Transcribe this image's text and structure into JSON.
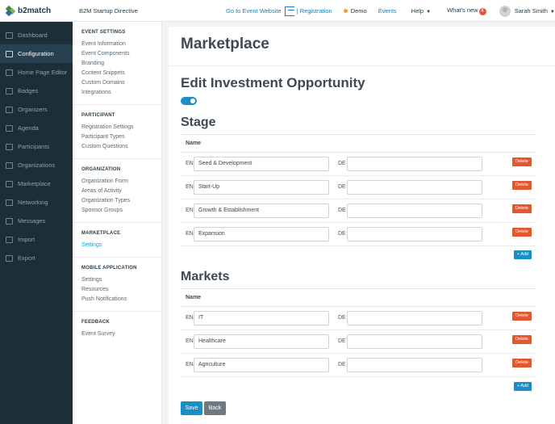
{
  "topbar": {
    "logo": "b2match",
    "event_name": "B2M Startup Directive",
    "go_to_website": "Go to Event Website",
    "registration": "| Registration",
    "demo": "Demo",
    "events": "Events",
    "help": "Help",
    "whats_new": "What's new",
    "whats_new_count": "4",
    "user_name": "Sarah Smith",
    "caret": "▼"
  },
  "sidebar": {
    "items": [
      {
        "label": "Dashboard",
        "icon": "dashboard-icon"
      },
      {
        "label": "Configuration",
        "icon": "configuration-icon"
      },
      {
        "label": "Home Page Editor",
        "icon": "home-page-editor-icon"
      },
      {
        "label": "Badges",
        "icon": "badges-icon"
      },
      {
        "label": "Organizers",
        "icon": "organizers-icon"
      },
      {
        "label": "Agenda",
        "icon": "agenda-icon"
      },
      {
        "label": "Participants",
        "icon": "participants-icon"
      },
      {
        "label": "Organizations",
        "icon": "organizations-icon"
      },
      {
        "label": "Marketplace",
        "icon": "marketplace-icon"
      },
      {
        "label": "Networking",
        "icon": "networking-icon"
      },
      {
        "label": "Messages",
        "icon": "messages-icon"
      },
      {
        "label": "Import",
        "icon": "import-icon"
      },
      {
        "label": "Export",
        "icon": "export-icon"
      }
    ],
    "active": "Configuration"
  },
  "settings_nav": {
    "groups": [
      {
        "heading": "EVENT SETTINGS",
        "links": [
          "Event Information",
          "Event Components",
          "Branding",
          "Content Snippets",
          "Custom Domains",
          "Integrations"
        ]
      },
      {
        "heading": "PARTICIPANT",
        "links": [
          "Registration Settings",
          "Participant Types",
          "Custom Questions"
        ]
      },
      {
        "heading": "ORGANIZATION",
        "links": [
          "Organization Form",
          "Areas of Activity",
          "Organization Types",
          "Sponsor Groups"
        ]
      },
      {
        "heading": "MARKETPLACE",
        "links": [
          "Settings"
        ]
      },
      {
        "heading": "MOBILE APPLICATION",
        "links": [
          "Settings",
          "Resources",
          "Push Notifications"
        ]
      },
      {
        "heading": "FEEDBACK",
        "links": [
          "Event Survey"
        ]
      }
    ],
    "active_link": "MARKETPLACE/Settings"
  },
  "main": {
    "page_title": "Marketplace",
    "form_title": "Edit Investment Opportunity",
    "toggle_on": true,
    "stage": {
      "title": "Stage",
      "column_name": "Name",
      "rows": [
        {
          "en_label": "EN",
          "en_value": "Seed & Development",
          "de_label": "DE",
          "de_value": "",
          "delete": "Delete"
        },
        {
          "en_label": "EN",
          "en_value": "Start-Up",
          "de_label": "DE",
          "de_value": "",
          "delete": "Delete"
        },
        {
          "en_label": "EN",
          "en_value": "Growth & Establishment",
          "de_label": "DE",
          "de_value": "",
          "delete": "Delete"
        },
        {
          "en_label": "EN",
          "en_value": "Expansion",
          "de_label": "DE",
          "de_value": "",
          "delete": "Delete"
        }
      ],
      "add_label": "+ Add"
    },
    "markets": {
      "title": "Markets",
      "column_name": "Name",
      "rows": [
        {
          "en_label": "EN",
          "en_value": "IT",
          "de_label": "DE",
          "de_value": "",
          "delete": "Delete"
        },
        {
          "en_label": "EN",
          "en_value": "Healthcare",
          "de_label": "DE",
          "de_value": "",
          "delete": "Delete"
        },
        {
          "en_label": "EN",
          "en_value": "Agriculture",
          "de_label": "DE",
          "de_value": "",
          "delete": "Delete"
        }
      ],
      "add_label": "+ Add"
    },
    "save_label": "Save",
    "back_label": "Back"
  },
  "colors": {
    "sidebar_bg": "#1c2e38",
    "accent_blue": "#1a8fc7",
    "delete_red": "#e4572e",
    "back_grey": "#6e7a82"
  }
}
